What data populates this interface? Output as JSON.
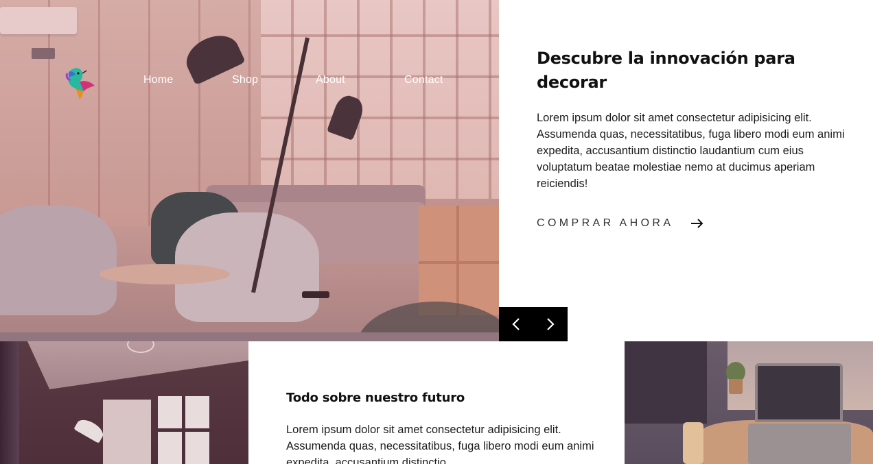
{
  "nav": {
    "logo_name": "hummingbird-logo",
    "links": [
      {
        "label": "Home"
      },
      {
        "label": "Shop"
      },
      {
        "label": "About"
      },
      {
        "label": "Contact"
      }
    ]
  },
  "hero": {
    "title": "Descubre la innovación para decorar",
    "description": "Lorem ipsum dolor sit amet consectetur adipisicing elit. Assumenda quas, necessitatibus, fuga libero modi eum animi expedita, accusantium distinctio laudantium cum eius voluptatum beatae molestiae nemo at ducimus aperiam reiciendis!",
    "cta_label": "COMPRAR AHORA",
    "cta_icon": "arrow-right-icon",
    "image_alt": "living-room-with-floor-lamp"
  },
  "slider": {
    "prev_icon": "chevron-left-icon",
    "next_icon": "chevron-right-icon"
  },
  "about": {
    "title": "Todo sobre nuestro futuro",
    "description": "Lorem ipsum dolor sit amet consectetur adipisicing elit. Assumenda quas, necessitatibus, fuga libero modi eum animi expedita, accusantium distinctio"
  },
  "colors": {
    "accent_dark": "#000000",
    "text": "#111111",
    "image_tint": "#aa3c50"
  }
}
